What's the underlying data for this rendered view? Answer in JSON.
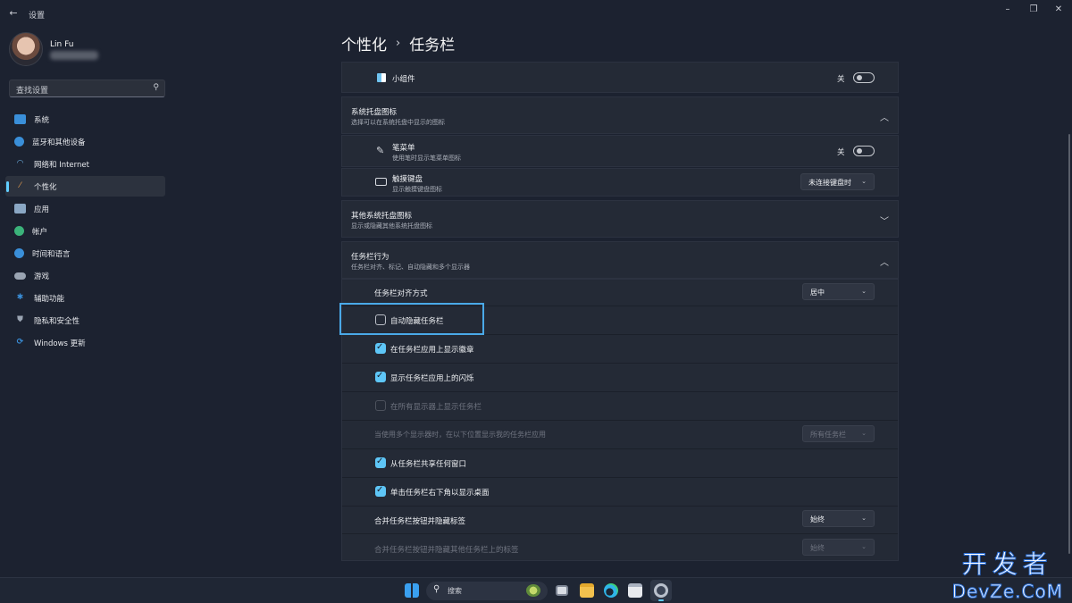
{
  "window": {
    "title": "设置",
    "back_icon": "back-arrow-icon",
    "controls": [
      "minimize-icon",
      "maximize-icon",
      "close-icon"
    ]
  },
  "user": {
    "name": "Lin Fu"
  },
  "search": {
    "placeholder": "查找设置",
    "icon": "search-icon"
  },
  "sidebar": {
    "items": [
      {
        "label": "系统",
        "icon": "system-icon",
        "color": "#3a8fd9"
      },
      {
        "label": "蓝牙和其他设备",
        "icon": "bluetooth-icon",
        "color": "#3a8fd9"
      },
      {
        "label": "网络和 Internet",
        "icon": "wifi-icon",
        "color": "#6fb4e8"
      },
      {
        "label": "个性化",
        "icon": "brush-icon",
        "color": "#e09a4e",
        "active": true
      },
      {
        "label": "应用",
        "icon": "apps-icon",
        "color": "#8aa7c4"
      },
      {
        "label": "帐户",
        "icon": "account-icon",
        "color": "#3bb37a"
      },
      {
        "label": "时间和语言",
        "icon": "clock-globe-icon",
        "color": "#3a8fd9"
      },
      {
        "label": "游戏",
        "icon": "gamepad-icon",
        "color": "#9aa4b2"
      },
      {
        "label": "辅助功能",
        "icon": "accessibility-icon",
        "color": "#3a8fd9"
      },
      {
        "label": "隐私和安全性",
        "icon": "shield-icon",
        "color": "#9aa4b2"
      },
      {
        "label": "Windows 更新",
        "icon": "windows-update-icon",
        "color": "#3a8fd9"
      }
    ]
  },
  "breadcrumb": {
    "parent": "个性化",
    "current": "任务栏"
  },
  "widgets": {
    "label": "小组件",
    "state": "关",
    "icon": "widgets-icon"
  },
  "tray": {
    "title": "系统托盘图标",
    "subtitle": "选择可以在系统托盘中显示的图标",
    "pen_menu": {
      "label": "笔菜单",
      "sub": "使用笔时显示笔菜单图标",
      "state": "关",
      "icon": "pen-icon"
    },
    "touch_kb": {
      "label": "触摸键盘",
      "sub": "显示触摸键盘图标",
      "value": "未连接键盘时",
      "icon": "keyboard-icon"
    }
  },
  "other_tray": {
    "title": "其他系统托盘图标",
    "subtitle": "显示或隐藏其他系统托盘图标"
  },
  "behaviors": {
    "title": "任务栏行为",
    "subtitle": "任务栏对齐、标记、自动隐藏和多个显示器",
    "alignment": {
      "label": "任务栏对齐方式",
      "value": "居中"
    },
    "auto_hide": {
      "label": "自动隐藏任务栏",
      "checked": false
    },
    "badges": {
      "label": "在任务栏应用上显示徽章",
      "checked": true
    },
    "flashing": {
      "label": "显示任务栏应用上的闪烁",
      "checked": true
    },
    "all_displays": {
      "label": "在所有显示器上显示任务栏",
      "checked": false,
      "disabled": true
    },
    "multi_display": {
      "label": "当使用多个显示器时，在以下位置显示我的任务栏应用",
      "value": "所有任务栏"
    },
    "share_window": {
      "label": "从任务栏共享任何窗口",
      "checked": true
    },
    "show_desktop": {
      "label": "单击任务栏右下角以显示桌面",
      "checked": true
    },
    "combine": {
      "label": "合并任务栏按钮并隐藏标签",
      "value": "始终"
    },
    "combine_other": {
      "label": "合并任务栏按钮并隐藏其他任务栏上的标签",
      "value": "始终"
    }
  },
  "taskbar": {
    "search_label": "搜索",
    "icons": [
      "windows-start-icon",
      "task-view-icon",
      "file-explorer-icon",
      "edge-icon",
      "store-icon",
      "settings-icon"
    ]
  },
  "watermark": {
    "line1": "开发者",
    "line2": "DevZe.CoM"
  },
  "colors": {
    "accent": "#60cdff",
    "highlight": "#4aa9e8",
    "background": "#1c2230",
    "card": "#242a36"
  }
}
